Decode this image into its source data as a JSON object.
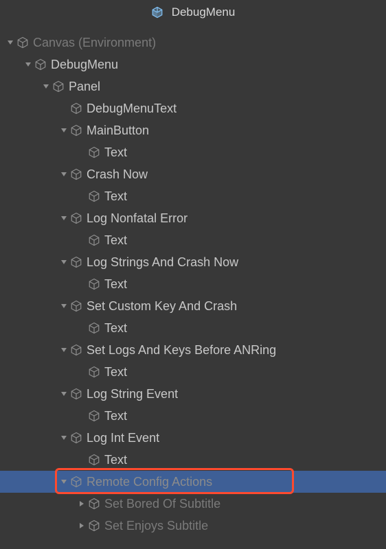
{
  "header": {
    "title": "DebugMenu"
  },
  "tree": {
    "canvas": "Canvas (Environment)",
    "debugMenu": "DebugMenu",
    "panel": "Panel",
    "items": [
      {
        "name": "DebugMenuText",
        "hasText": false
      },
      {
        "name": "MainButton",
        "hasText": true,
        "text": "Text"
      },
      {
        "name": "Crash Now",
        "hasText": true,
        "text": "Text"
      },
      {
        "name": "Log Nonfatal Error",
        "hasText": true,
        "text": "Text"
      },
      {
        "name": "Log Strings And Crash Now",
        "hasText": true,
        "text": "Text"
      },
      {
        "name": "Set Custom Key And Crash",
        "hasText": true,
        "text": "Text"
      },
      {
        "name": "Set Logs And Keys Before ANRing",
        "hasText": true,
        "text": "Text"
      },
      {
        "name": "Log String Event",
        "hasText": true,
        "text": "Text"
      },
      {
        "name": "Log Int Event",
        "hasText": true,
        "text": "Text"
      }
    ],
    "remoteConfig": "Remote Config Actions",
    "children": [
      "Set Bored Of Subtitle",
      "Set Enjoys Subtitle"
    ]
  },
  "colors": {
    "prefabIcon": "#7db8e8",
    "grayIcon": "#8e8e8e",
    "highlight": "#ff4a2e",
    "selection": "#3e5f96"
  }
}
